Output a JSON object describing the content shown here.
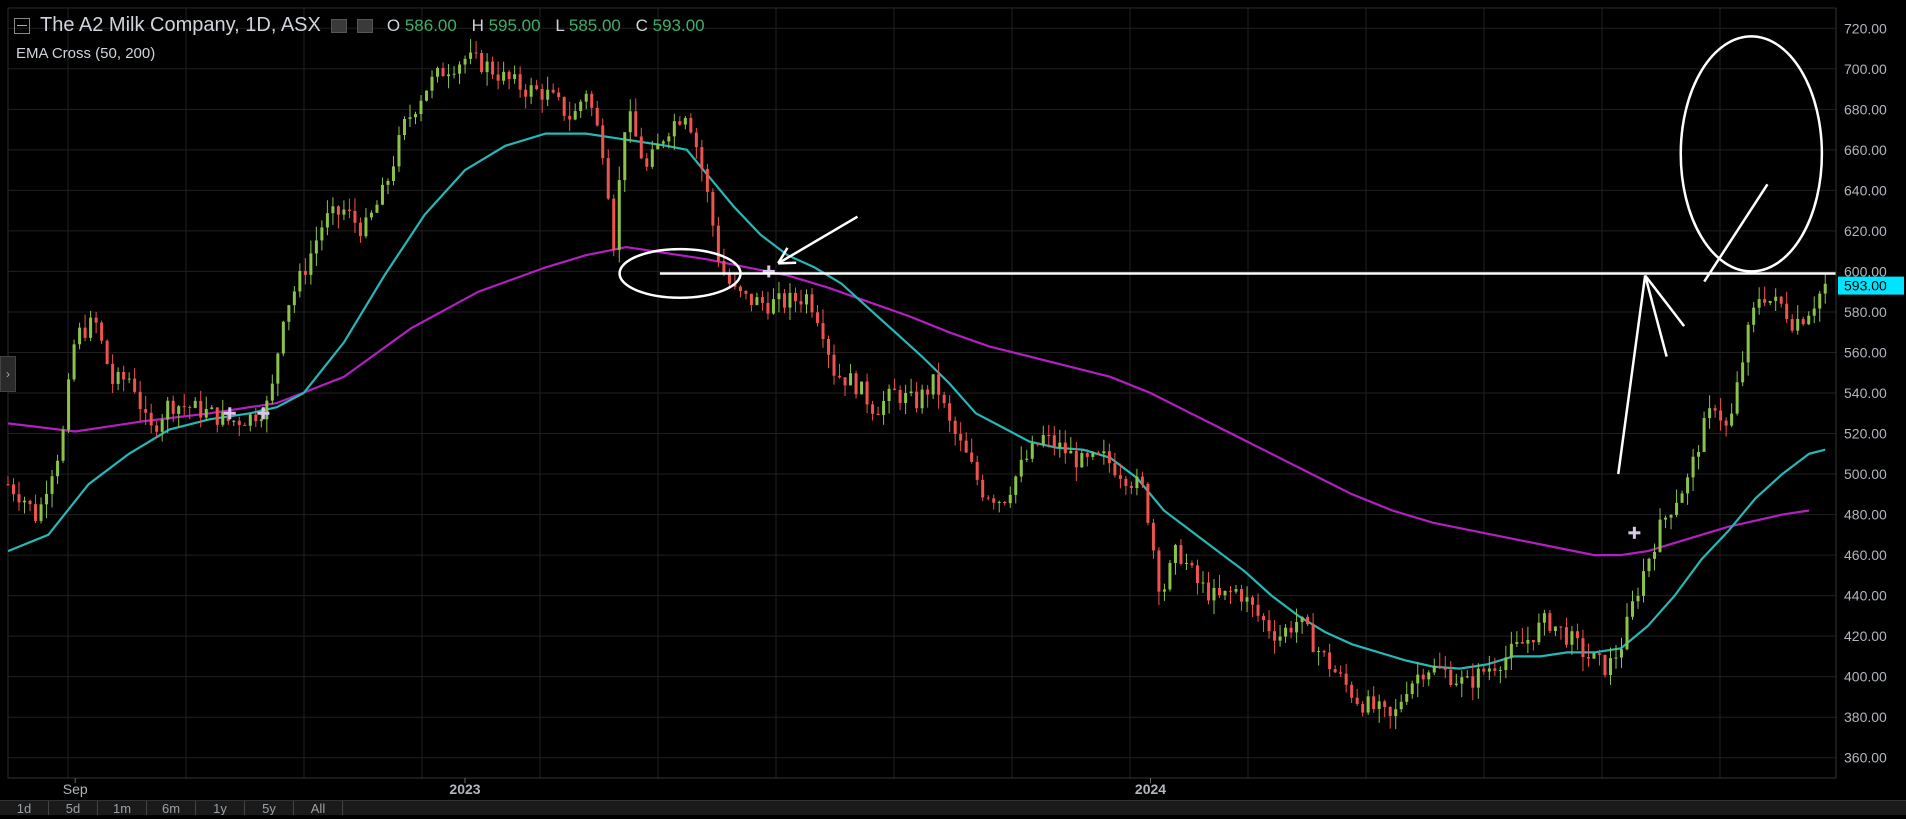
{
  "header": {
    "title": "The A2 Milk Company, 1D, ASX",
    "ohlc": [
      {
        "label": "O",
        "value": "586.00"
      },
      {
        "label": "H",
        "value": "595.00"
      },
      {
        "label": "L",
        "value": "585.00"
      },
      {
        "label": "C",
        "value": "593.00"
      }
    ],
    "indicator": "EMA Cross (50, 200)"
  },
  "timeframes": [
    "1d",
    "5d",
    "1m",
    "6m",
    "1y",
    "5y",
    "All"
  ],
  "colors": {
    "up": "#8bc34a",
    "down": "#ef5350",
    "ema50": "#26b7b7",
    "ema200": "#b31fc0",
    "annotation": "#ffffff",
    "price_tag": "#00e5ff",
    "grid": "#1f1f1f",
    "axis_text": "#b2b5be"
  },
  "chart_data": {
    "type": "candlestick",
    "title": "The A2 Milk Company, 1D, ASX",
    "y_axis_ticks": [
      360,
      380,
      400,
      420,
      440,
      460,
      480,
      500,
      520,
      540,
      560,
      580,
      600,
      620,
      640,
      660,
      680,
      700,
      720
    ],
    "y_tick_labels": [
      "360.00",
      "380.00",
      "400.00",
      "420.00",
      "440.00",
      "460.00",
      "480.00",
      "500.00",
      "520.00",
      "540.00",
      "560.00",
      "580.00",
      "600.00",
      "620.00",
      "640.00",
      "660.00",
      "680.00",
      "700.00",
      "720.00"
    ],
    "ylim": [
      350,
      730
    ],
    "x_labels": [
      {
        "label": "Sep",
        "t": 0.05
      },
      {
        "label": "2023",
        "t": 0.34
      },
      {
        "label": "2024",
        "t": 0.85
      }
    ],
    "last_price": {
      "value": 593,
      "label": "593.00"
    },
    "horizontal_line": 599,
    "price_path": [
      [
        0.0,
        495
      ],
      [
        0.012,
        488
      ],
      [
        0.022,
        478
      ],
      [
        0.03,
        498
      ],
      [
        0.04,
        515
      ],
      [
        0.05,
        568
      ],
      [
        0.065,
        575
      ],
      [
        0.078,
        545
      ],
      [
        0.092,
        548
      ],
      [
        0.105,
        520
      ],
      [
        0.12,
        535
      ],
      [
        0.135,
        533
      ],
      [
        0.15,
        530
      ],
      [
        0.165,
        526
      ],
      [
        0.18,
        528
      ],
      [
        0.195,
        535
      ],
      [
        0.205,
        580
      ],
      [
        0.22,
        600
      ],
      [
        0.235,
        625
      ],
      [
        0.25,
        630
      ],
      [
        0.265,
        620
      ],
      [
        0.28,
        640
      ],
      [
        0.295,
        672
      ],
      [
        0.31,
        690
      ],
      [
        0.325,
        700
      ],
      [
        0.34,
        705
      ],
      [
        0.355,
        702
      ],
      [
        0.37,
        695
      ],
      [
        0.385,
        690
      ],
      [
        0.4,
        688
      ],
      [
        0.41,
        682
      ],
      [
        0.42,
        675
      ],
      [
        0.43,
        690
      ],
      [
        0.445,
        655
      ],
      [
        0.45,
        610
      ],
      [
        0.46,
        680
      ],
      [
        0.475,
        650
      ],
      [
        0.49,
        670
      ],
      [
        0.505,
        680
      ],
      [
        0.515,
        655
      ],
      [
        0.522,
        632
      ],
      [
        0.53,
        602
      ],
      [
        0.54,
        590
      ],
      [
        0.55,
        586
      ],
      [
        0.565,
        584
      ],
      [
        0.58,
        585
      ],
      [
        0.595,
        588
      ],
      [
        0.605,
        575
      ],
      [
        0.615,
        550
      ],
      [
        0.63,
        545
      ],
      [
        0.645,
        532
      ],
      [
        0.66,
        540
      ],
      [
        0.675,
        535
      ],
      [
        0.69,
        546
      ],
      [
        0.7,
        525
      ],
      [
        0.712,
        510
      ],
      [
        0.725,
        492
      ],
      [
        0.74,
        487
      ],
      [
        0.755,
        505
      ],
      [
        0.77,
        518
      ],
      [
        0.785,
        512
      ],
      [
        0.8,
        505
      ],
      [
        0.815,
        508
      ],
      [
        0.83,
        500
      ],
      [
        0.845,
        492
      ],
      [
        0.858,
        440
      ],
      [
        0.87,
        463
      ],
      [
        0.885,
        446
      ],
      [
        0.9,
        438
      ],
      [
        0.915,
        443
      ],
      [
        0.93,
        430
      ],
      [
        0.945,
        420
      ],
      [
        0.96,
        428
      ],
      [
        0.975,
        413
      ],
      [
        0.99,
        400
      ],
      [
        1.005,
        388
      ],
      [
        1.02,
        383
      ],
      [
        1.03,
        378
      ],
      [
        1.04,
        395
      ],
      [
        1.055,
        405
      ],
      [
        1.07,
        402
      ],
      [
        1.085,
        396
      ],
      [
        1.1,
        404
      ],
      [
        1.115,
        410
      ],
      [
        1.13,
        418
      ],
      [
        1.145,
        428
      ],
      [
        1.16,
        420
      ],
      [
        1.175,
        410
      ],
      [
        1.19,
        404
      ],
      [
        1.2,
        415
      ],
      [
        1.21,
        438
      ],
      [
        1.22,
        458
      ],
      [
        1.23,
        475
      ],
      [
        1.24,
        487
      ],
      [
        1.25,
        497
      ],
      [
        1.26,
        520
      ],
      [
        1.27,
        535
      ],
      [
        1.28,
        520
      ],
      [
        1.288,
        548
      ],
      [
        1.296,
        574
      ],
      [
        1.304,
        590
      ],
      [
        1.312,
        585
      ],
      [
        1.32,
        583
      ],
      [
        1.328,
        575
      ],
      [
        1.336,
        578
      ],
      [
        1.344,
        585
      ],
      [
        1.352,
        593
      ]
    ],
    "series": [
      {
        "name": "EMA 50",
        "points": [
          [
            0.0,
            462
          ],
          [
            0.03,
            470
          ],
          [
            0.06,
            495
          ],
          [
            0.09,
            510
          ],
          [
            0.12,
            522
          ],
          [
            0.15,
            527
          ],
          [
            0.18,
            530
          ],
          [
            0.2,
            533
          ],
          [
            0.22,
            540
          ],
          [
            0.25,
            565
          ],
          [
            0.28,
            598
          ],
          [
            0.31,
            628
          ],
          [
            0.34,
            650
          ],
          [
            0.37,
            662
          ],
          [
            0.4,
            668
          ],
          [
            0.43,
            668
          ],
          [
            0.46,
            665
          ],
          [
            0.49,
            662
          ],
          [
            0.505,
            660
          ],
          [
            0.52,
            648
          ],
          [
            0.54,
            632
          ],
          [
            0.56,
            618
          ],
          [
            0.58,
            608
          ],
          [
            0.6,
            602
          ],
          [
            0.62,
            594
          ],
          [
            0.64,
            582
          ],
          [
            0.66,
            570
          ],
          [
            0.68,
            558
          ],
          [
            0.7,
            545
          ],
          [
            0.72,
            530
          ],
          [
            0.74,
            523
          ],
          [
            0.76,
            516
          ],
          [
            0.78,
            513
          ],
          [
            0.8,
            512
          ],
          [
            0.82,
            508
          ],
          [
            0.84,
            498
          ],
          [
            0.86,
            482
          ],
          [
            0.88,
            472
          ],
          [
            0.9,
            462
          ],
          [
            0.92,
            452
          ],
          [
            0.94,
            440
          ],
          [
            0.96,
            430
          ],
          [
            0.98,
            422
          ],
          [
            1.0,
            416
          ],
          [
            1.02,
            412
          ],
          [
            1.04,
            408
          ],
          [
            1.06,
            405
          ],
          [
            1.08,
            404
          ],
          [
            1.1,
            406
          ],
          [
            1.12,
            410
          ],
          [
            1.14,
            410
          ],
          [
            1.16,
            412
          ],
          [
            1.18,
            412
          ],
          [
            1.2,
            414
          ],
          [
            1.22,
            425
          ],
          [
            1.24,
            440
          ],
          [
            1.26,
            458
          ],
          [
            1.28,
            472
          ],
          [
            1.3,
            488
          ],
          [
            1.32,
            500
          ],
          [
            1.34,
            510
          ],
          [
            1.352,
            512
          ]
        ]
      },
      {
        "name": "EMA 200",
        "points": [
          [
            0.0,
            525
          ],
          [
            0.05,
            521
          ],
          [
            0.1,
            526
          ],
          [
            0.15,
            530
          ],
          [
            0.2,
            535
          ],
          [
            0.25,
            548
          ],
          [
            0.3,
            572
          ],
          [
            0.35,
            590
          ],
          [
            0.4,
            602
          ],
          [
            0.43,
            608
          ],
          [
            0.46,
            612
          ],
          [
            0.49,
            609
          ],
          [
            0.52,
            606
          ],
          [
            0.55,
            602
          ],
          [
            0.58,
            598
          ],
          [
            0.61,
            592
          ],
          [
            0.64,
            585
          ],
          [
            0.67,
            578
          ],
          [
            0.7,
            570
          ],
          [
            0.73,
            563
          ],
          [
            0.76,
            558
          ],
          [
            0.79,
            553
          ],
          [
            0.82,
            548
          ],
          [
            0.85,
            540
          ],
          [
            0.88,
            530
          ],
          [
            0.91,
            520
          ],
          [
            0.94,
            510
          ],
          [
            0.97,
            500
          ],
          [
            1.0,
            490
          ],
          [
            1.03,
            482
          ],
          [
            1.06,
            476
          ],
          [
            1.09,
            472
          ],
          [
            1.12,
            468
          ],
          [
            1.15,
            464
          ],
          [
            1.18,
            460
          ],
          [
            1.2,
            460
          ],
          [
            1.22,
            462
          ],
          [
            1.24,
            466
          ],
          [
            1.26,
            470
          ],
          [
            1.28,
            474
          ],
          [
            1.3,
            477
          ],
          [
            1.32,
            480
          ],
          [
            1.34,
            482
          ]
        ]
      }
    ],
    "cross_markers": [
      [
        0.165,
        530
      ],
      [
        0.19,
        530
      ],
      [
        0.566,
        600
      ],
      [
        1.21,
        471
      ]
    ],
    "annotations": [
      {
        "type": "ellipse",
        "cx": 0.5,
        "cy": 599,
        "rx": 0.045,
        "ry": 12
      },
      {
        "type": "ellipse",
        "cx": 1.297,
        "cy": 658,
        "rx": 0.0525,
        "ry": 58
      },
      {
        "type": "arrow",
        "from": [
          0.632,
          627
        ],
        "to": [
          0.573,
          604
        ]
      },
      {
        "type": "line",
        "from": [
          1.262,
          595
        ],
        "to": [
          1.309,
          643
        ]
      },
      {
        "type": "line",
        "from": [
          1.198,
          500
        ],
        "to": [
          1.218,
          598
        ]
      },
      {
        "type": "line",
        "from": [
          1.218,
          598
        ],
        "to": [
          1.247,
          573
        ]
      },
      {
        "type": "line",
        "from": [
          1.218,
          598
        ],
        "to": [
          1.234,
          558
        ]
      }
    ],
    "grid": true
  }
}
